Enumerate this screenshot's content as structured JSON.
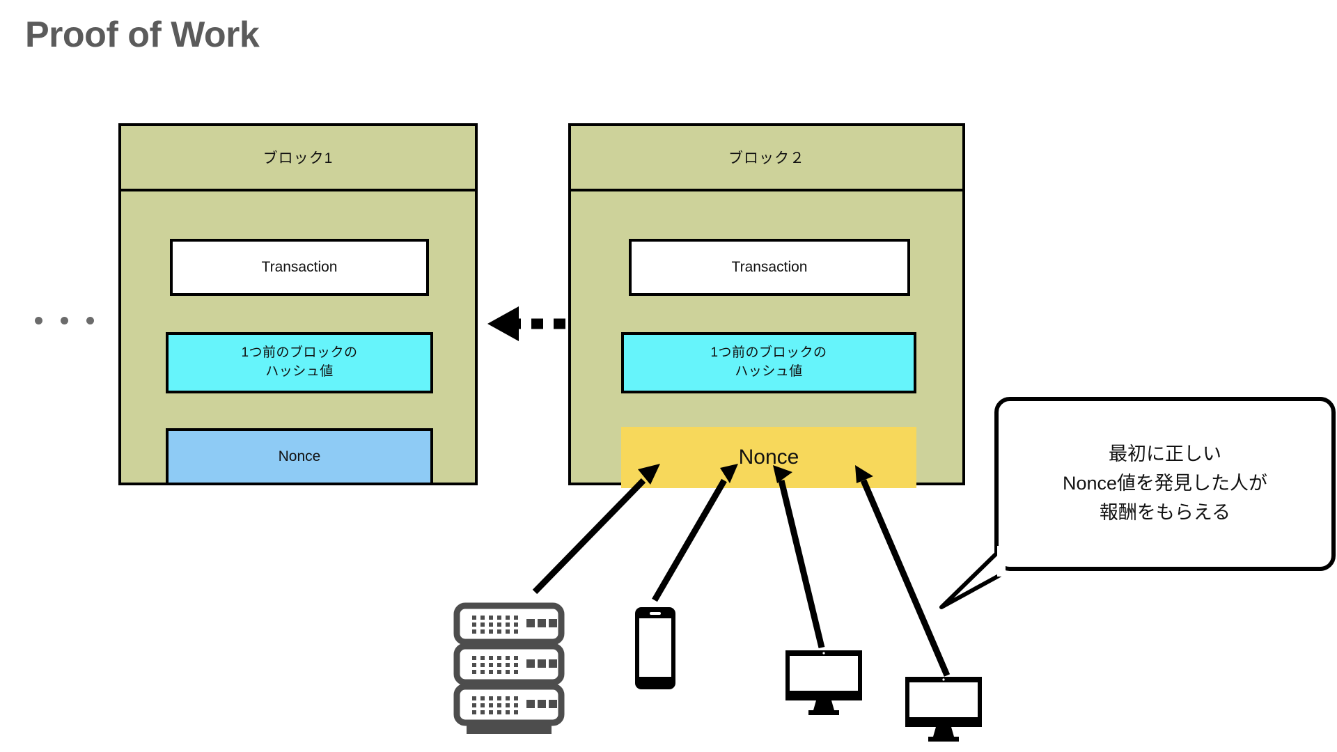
{
  "page": {
    "title": "Proof of Work",
    "title_color": "#5b5b5b",
    "background": "#ffffff"
  },
  "chain": {
    "ellipsis_label": "...",
    "link_arrow": "dotted-left-arrow"
  },
  "blocks": [
    {
      "id": "block-1",
      "header": "ブロック1",
      "fill": "#cdd29a",
      "rows": [
        {
          "name": "transaction",
          "label": "Transaction",
          "fill": "#ffffff"
        },
        {
          "name": "previous-hash",
          "label": "1つ前のブロックの\nハッシュ値",
          "line1": "1つ前のブロックの",
          "line2": "ハッシュ値",
          "fill": "#66f4fb"
        },
        {
          "name": "nonce",
          "label": "Nonce",
          "fill": "#8ecbf5",
          "highlighted": false
        }
      ]
    },
    {
      "id": "block-2",
      "header": "ブロック２",
      "fill": "#cdd29a",
      "rows": [
        {
          "name": "transaction",
          "label": "Transaction",
          "fill": "#ffffff"
        },
        {
          "name": "previous-hash",
          "label": "1つ前のブロックの\nハッシュ値",
          "line1": "1つ前のブロックの",
          "line2": "ハッシュ値",
          "fill": "#66f4fb"
        },
        {
          "name": "nonce",
          "label": "Nonce",
          "fill": "#f7d85b",
          "highlighted": true
        }
      ]
    }
  ],
  "callout": {
    "line1": "最初に正しい",
    "line2": "Nonce値を発見した人が",
    "line3": "報酬をもらえる",
    "border_color": "#000000",
    "fill": "#ffffff"
  },
  "miners": [
    {
      "name": "server-icon",
      "type": "server",
      "color": "#4d4d4d"
    },
    {
      "name": "smartphone-icon",
      "type": "smartphone",
      "color": "#000000"
    },
    {
      "name": "desktop-monitor-icon",
      "type": "monitor",
      "color": "#000000"
    },
    {
      "name": "desktop-monitor-icon-2",
      "type": "monitor",
      "color": "#000000"
    }
  ],
  "arrows": {
    "count": 4,
    "target": "block-2-nonce",
    "color": "#000000"
  }
}
